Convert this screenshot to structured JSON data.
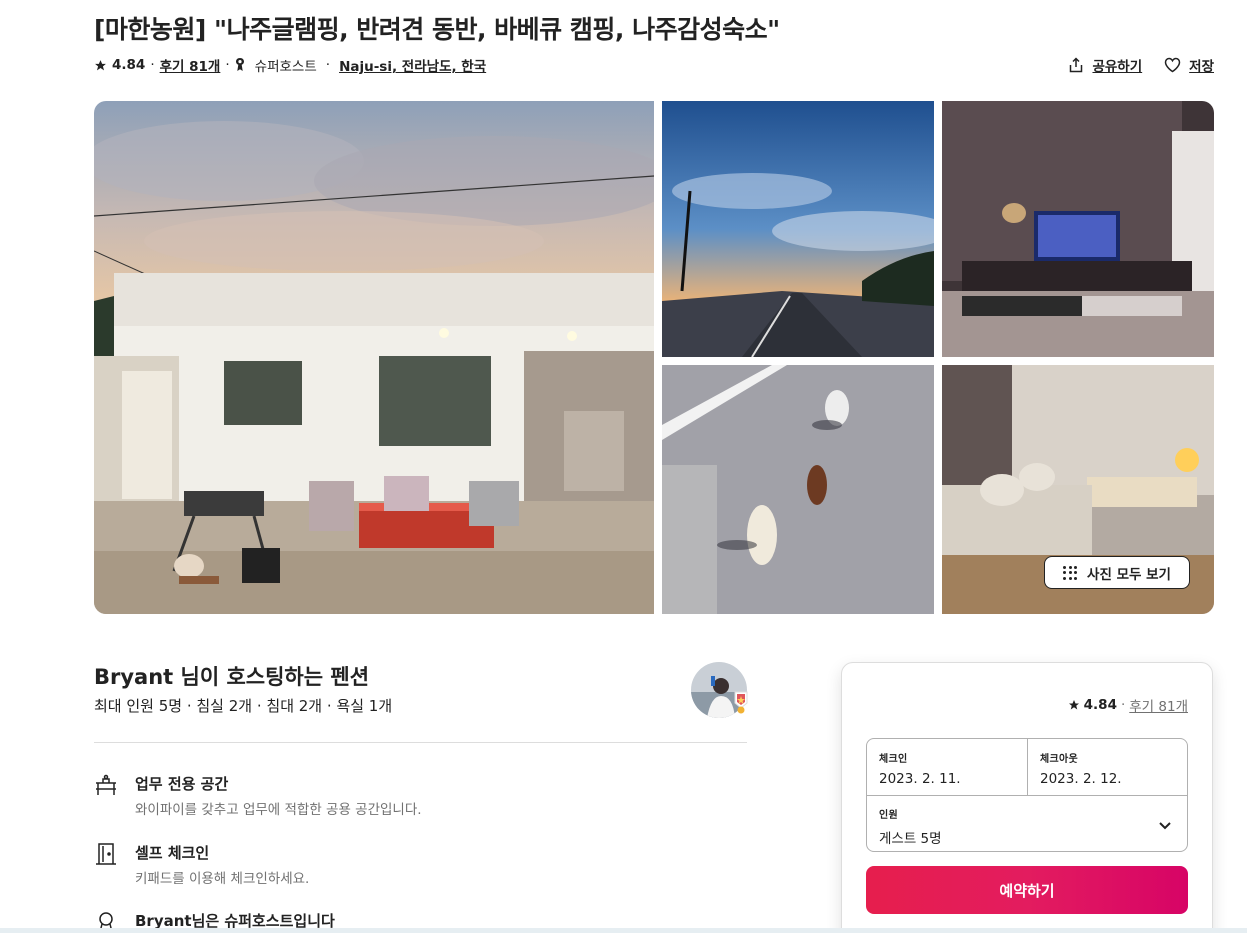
{
  "listing": {
    "title": "[마한농원] \"나주글램핑, 반려견 동반, 바베큐 캠핑, 나주감성숙소\"",
    "rating": "4.84",
    "reviews": "후기 81개",
    "superhost": "슈퍼호스트",
    "location": "Naju-si, 전라남도, 한국"
  },
  "actions": {
    "share": "공유하기",
    "save": "저장"
  },
  "gallery": {
    "show_all": "사진 모두 보기"
  },
  "host": {
    "title": "Bryant 님이 호스팅하는 펜션",
    "summary": "최대 인원 5명 · 침실 2개 · 침대 2개 · 욕실 1개"
  },
  "features": [
    {
      "icon": "workspace-icon",
      "title": "업무 전용 공간",
      "desc": "와이파이를 갖추고 업무에 적합한 공용 공간입니다."
    },
    {
      "icon": "door-icon",
      "title": "셀프 체크인",
      "desc": "키패드를 이용해 체크인하세요."
    },
    {
      "icon": "superhost-medal-icon",
      "title": "Bryant님은 슈퍼호스트입니다",
      "desc": ""
    }
  ],
  "booking": {
    "rating": "4.84",
    "reviews": "후기 81개",
    "checkin_label": "체크인",
    "checkin_value": "2023. 2. 11.",
    "checkout_label": "체크아웃",
    "checkout_value": "2023. 2. 12.",
    "guests_label": "인원",
    "guests_value": "게스트 5명",
    "reserve_label": "예약하기"
  },
  "colors": {
    "brand": "#e31c5f",
    "text": "#222222",
    "muted": "#717171",
    "border": "#dddddd"
  }
}
